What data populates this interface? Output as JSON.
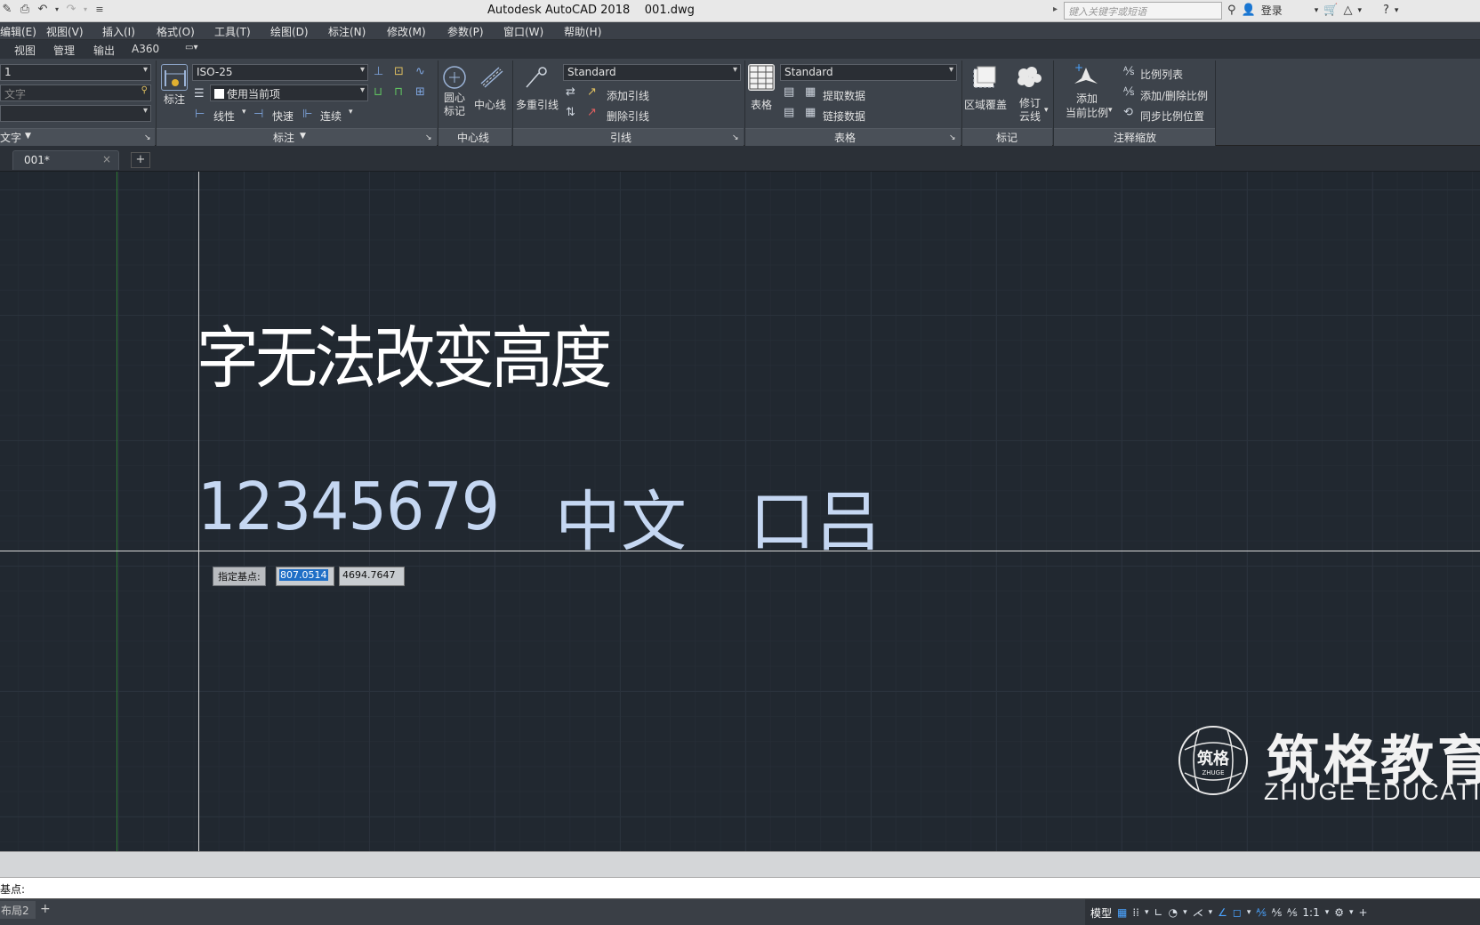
{
  "titlebar": {
    "app_title": "Autodesk AutoCAD 2018    001.dwg",
    "search_placeholder": "键入关键字或短语",
    "login_label": "登录"
  },
  "menu": {
    "items": [
      "编辑(E)",
      "视图(V)",
      "插入(I)",
      "格式(O)",
      "工具(T)",
      "绘图(D)",
      "标注(N)",
      "修改(M)",
      "参数(P)",
      "窗口(W)",
      "帮助(H)"
    ]
  },
  "ribbon_tabs": [
    "视图",
    "管理",
    "输出",
    "A360"
  ],
  "ribbon": {
    "text_style_value": "1",
    "find_text_placeholder": "文字",
    "text_panel_title": "文字",
    "dim_style_value": "ISO-25",
    "dim_layer_value": "使用当前项",
    "dim_big_label": "标注",
    "dim_linear": "线性",
    "dim_quick": "快速",
    "dim_continue": "连续",
    "dim_panel_title": "标注",
    "centermark_label": "圆心\n标记",
    "centerline_label": "中心线",
    "center_panel_title": "中心线",
    "mleader_label": "多重引线",
    "mleader_style_value": "Standard",
    "add_leader": "添加引线",
    "remove_leader": "删除引线",
    "leader_panel_title": "引线",
    "table_label": "表格",
    "table_style_value": "Standard",
    "extract_data": "提取数据",
    "link_data": "链接数据",
    "table_panel_title": "表格",
    "wipeout_label": "区域覆盖",
    "revcloud_label": "修订\n云线",
    "markup_panel_title": "标记",
    "add_scale_label": "添加\n当前比例",
    "scale_list": "比例列表",
    "add_remove_scale": "添加/删除比例",
    "sync_scale": "同步比例位置",
    "annoscale_panel_title": "注释缩放"
  },
  "doc_tab": {
    "label": "001*"
  },
  "drawing": {
    "text_line1": "字无法改变高度",
    "text_line2_numbers": "12345679",
    "text_line2_cn": "中文   口吕",
    "prompt_label": "指定基点:",
    "prompt_x": "807.0514",
    "prompt_y": "4694.7647"
  },
  "watermark": {
    "logo_text": "筑格",
    "logo_sub": "ZHUGE",
    "title_cn": "筑格教育",
    "title_en": "ZHUGE EDUCATION"
  },
  "command": {
    "current_prompt": "基点:"
  },
  "statusbar": {
    "layout_tab": "布局2",
    "model_label": "模型",
    "scale_label": "1:1"
  }
}
